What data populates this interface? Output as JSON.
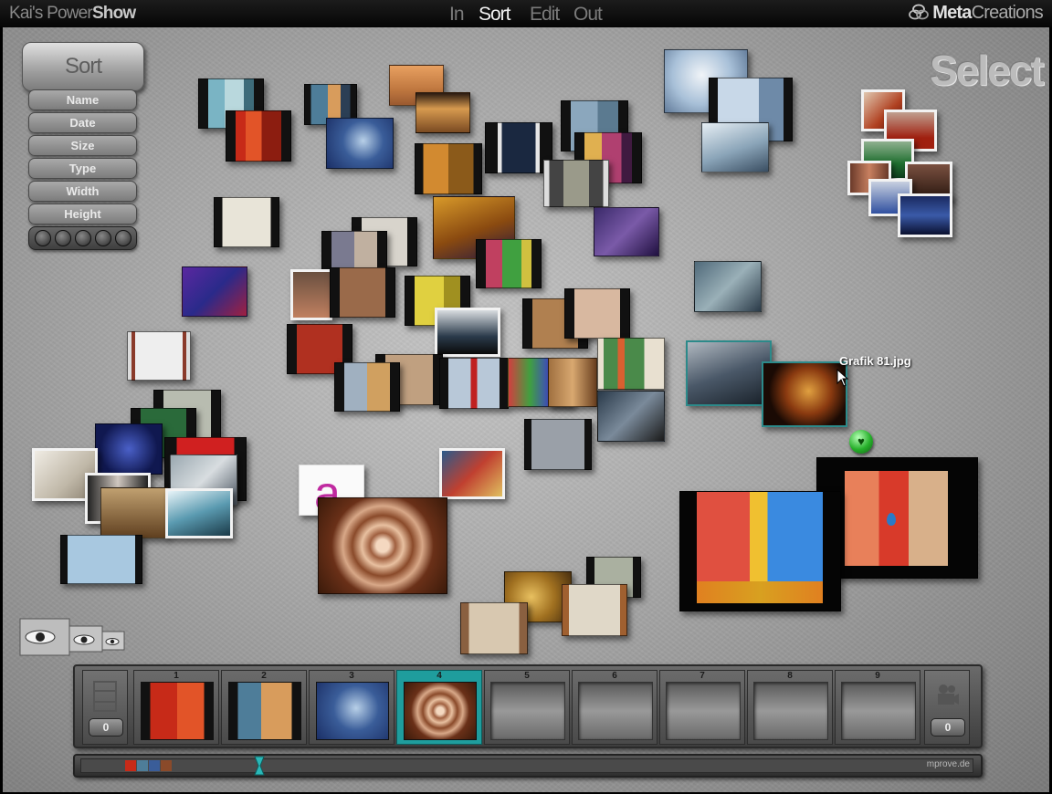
{
  "app": {
    "brand_prefix": "Kai's Power",
    "brand_suffix": "Show",
    "vendor_prefix": "Meta",
    "vendor_suffix": "Creations"
  },
  "modes": [
    {
      "label": "In",
      "active": false
    },
    {
      "label": "Sort",
      "active": true
    },
    {
      "label": "Edit",
      "active": false
    },
    {
      "label": "Out",
      "active": false
    }
  ],
  "sort_panel": {
    "title": "Sort",
    "options": [
      "Name",
      "Date",
      "Size",
      "Type",
      "Width",
      "Height"
    ]
  },
  "select_title": "Select",
  "hover_tooltip": "Grafik 81.jpg",
  "filmstrip": {
    "slots": [
      {
        "number": "1",
        "filled": true,
        "active": false
      },
      {
        "number": "2",
        "filled": true,
        "active": false
      },
      {
        "number": "3",
        "filled": true,
        "active": false
      },
      {
        "number": "4",
        "filled": true,
        "active": true
      },
      {
        "number": "5",
        "filled": false,
        "active": false
      },
      {
        "number": "6",
        "filled": false,
        "active": false
      },
      {
        "number": "7",
        "filled": false,
        "active": false
      },
      {
        "number": "8",
        "filled": false,
        "active": false
      },
      {
        "number": "9",
        "filled": false,
        "active": false
      }
    ],
    "left_count": "0",
    "right_count": "0"
  },
  "timeline": {
    "credit": "mprove.de"
  },
  "colors": {
    "accent_teal": "#1f9d9d",
    "heart_green": "#26b02a"
  }
}
